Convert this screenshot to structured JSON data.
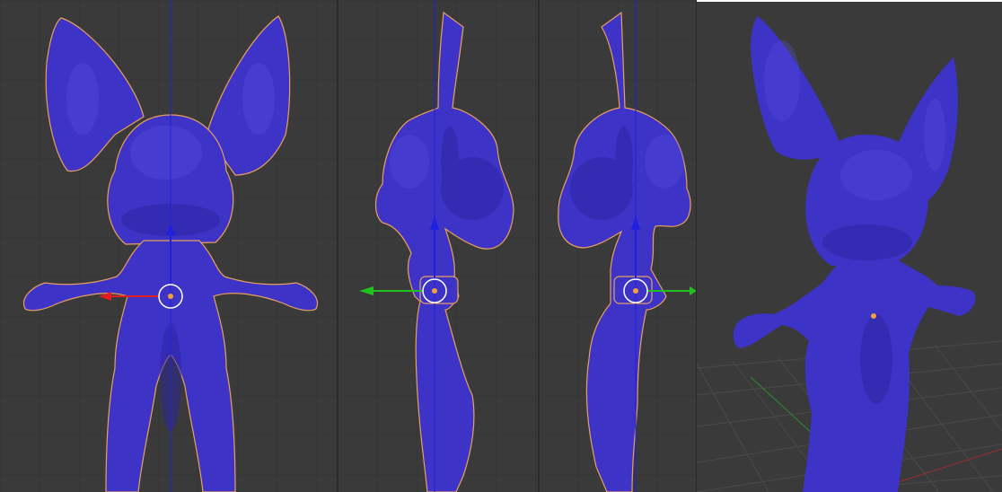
{
  "app": {
    "colors": {
      "viewport_bg": "#3a3a3a",
      "grid_line": "#333333",
      "mesh_fill": "#3d33c6",
      "mesh_shadow": "#2b24a0",
      "mesh_highlight": "#5a50e0",
      "selection_outline": "#e8a060",
      "axis_x": "#e02020",
      "axis_y": "#20c020",
      "axis_z": "#2020e0",
      "origin_dot": "#f0a040",
      "pivot_ring": "#ffffff"
    }
  },
  "viewports": [
    {
      "view": "front",
      "object": "character-mesh",
      "gizmo_axes": [
        "z",
        "x"
      ]
    },
    {
      "view": "side-left",
      "object": "character-mesh",
      "gizmo_axes": [
        "z",
        "y"
      ]
    },
    {
      "view": "side-right",
      "object": "character-mesh",
      "gizmo_axes": [
        "z",
        "y"
      ]
    },
    {
      "view": "perspective",
      "object": "character-mesh",
      "gizmo_axes": []
    }
  ]
}
